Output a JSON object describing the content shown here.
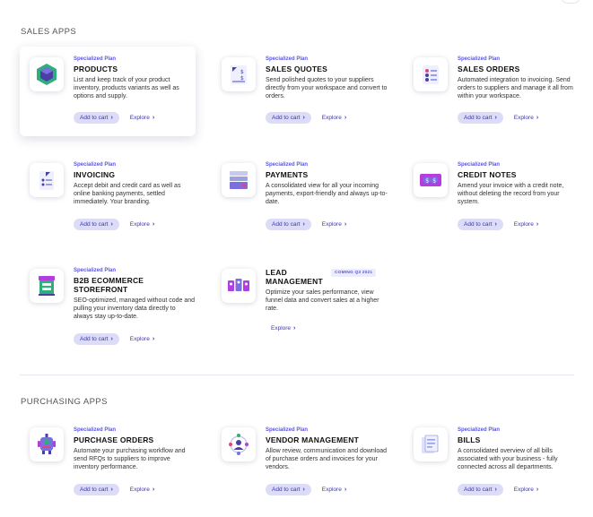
{
  "sections": {
    "sales": "SALES APPS",
    "purchasing": "PURCHASING APPS"
  },
  "labels": {
    "plan": "Specialized Plan",
    "add_to_cart": "Add to cart",
    "explore": "Explore",
    "chevron": "›"
  },
  "sales_apps": [
    {
      "name": "PRODUCTS",
      "desc": "List and keep track of your product inventory, products variants as well as options and supply.",
      "icon": "cube-icon"
    },
    {
      "name": "SALES QUOTES",
      "desc": "Send polished quotes to your suppliers directly from your workspace and convert to orders.",
      "icon": "quote-document-icon"
    },
    {
      "name": "SALES ORDERS",
      "desc": "Automated integration to invoicing. Send orders to suppliers and manage it all from within your workspace.",
      "icon": "order-list-icon"
    },
    {
      "name": "INVOICING",
      "desc": "Accept debit and credit card as well as online banking payments, settled immediately. Your branding.",
      "icon": "invoice-icon"
    },
    {
      "name": "PAYMENTS",
      "desc": "A consolidated view for all your incoming payments, export-friendly and always up-to-date.",
      "icon": "payment-stack-icon"
    },
    {
      "name": "CREDIT NOTES",
      "desc": "Amend your invoice with a credit note, without deleting the record from your system.",
      "icon": "credit-note-icon"
    },
    {
      "name": "B2B ECOMMERCE STOREFRONT",
      "desc": "SEO-optimized, managed without code and pulling your inventory data directly to always stay up-to-date.",
      "icon": "storefront-icon"
    },
    {
      "name": "LEAD MANAGEMENT",
      "desc": "Optimize your sales performance, view funnel data and convert sales at a higher rate.",
      "icon": "lead-cards-icon",
      "badge": "COMING Q3 2021"
    }
  ],
  "purchasing_apps": [
    {
      "name": "PURCHASE ORDERS",
      "desc": "Automate your purchasing workflow and send RFQs to suppliers to improve inventory performance.",
      "icon": "robot-icon"
    },
    {
      "name": "VENDOR MANAGEMENT",
      "desc": "Allow review, communication and download of purchase orders and invoices for your vendors.",
      "icon": "vendor-network-icon"
    },
    {
      "name": "BILLS",
      "desc": "A consolidated overview of all bills associated with your business - fully connected across all departments.",
      "icon": "bills-icon"
    }
  ],
  "colors": {
    "accent": "#5b56d8",
    "button_bg": "#dcdcf6",
    "button_text": "#3d36b5"
  }
}
